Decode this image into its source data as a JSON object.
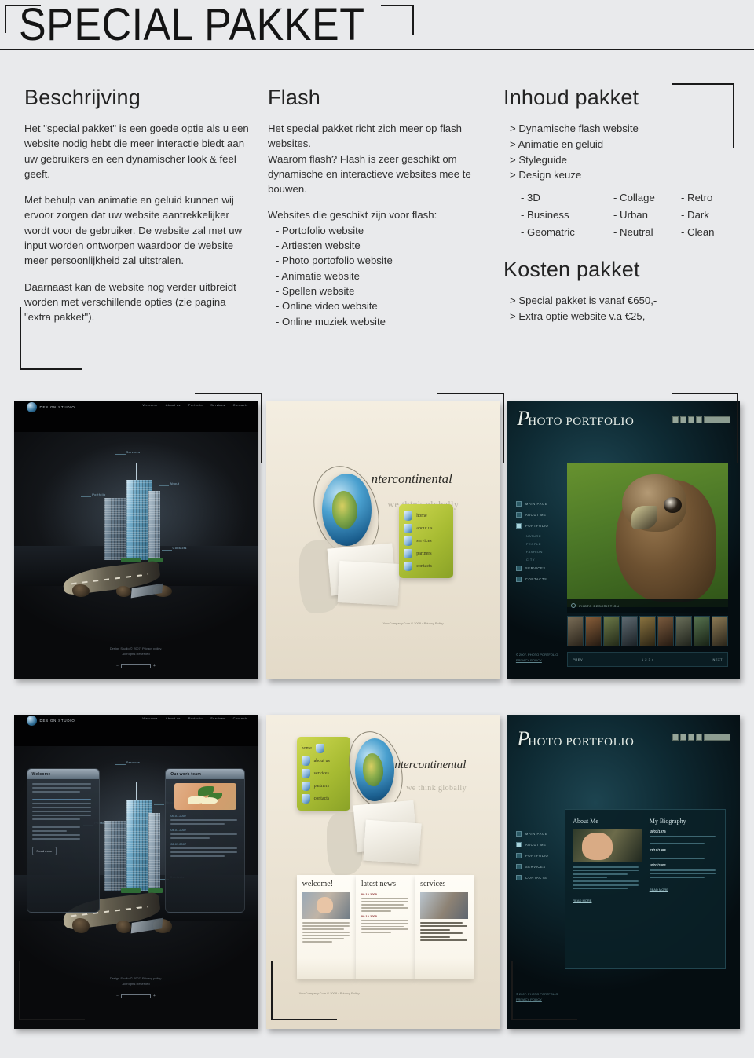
{
  "header": {
    "title": "SPECIAL PAKKET"
  },
  "col1": {
    "title": "Beschrijving",
    "p1": "Het \"special pakket\" is een goede optie als u een website nodig hebt die meer interactie biedt aan uw gebruikers en een dynamischer look & feel geeft.",
    "p2": "Met behulp van animatie en geluid kunnen wij ervoor zorgen dat uw website aantrekkelijker wordt voor de gebruiker. De website zal met uw input worden ontworpen waardoor de website meer persoonlijkheid zal uitstralen.",
    "p3": "Daarnaast kan de website nog verder uitbreidt worden met verschillende opties (zie pagina \"extra pakket\")."
  },
  "col2": {
    "title": "Flash",
    "p1": "Het special pakket richt zich meer op flash websites.",
    "p2": "Waarom flash? Flash is zeer geschikt om dynamische en interactieve websites mee te bouwen.",
    "list_intro": "Websites die geschikt zijn voor flash:",
    "items": [
      "- Portofolio website",
      "- Artiesten website",
      "- Photo portofolio website",
      "- Animatie website",
      "- Spellen website",
      "- Online video website",
      "- Online muziek website"
    ]
  },
  "col3": {
    "title": "Inhoud pakket",
    "items": [
      "> Dynamische flash website",
      "> Animatie en geluid",
      "> Styleguide",
      "> Design keuze"
    ],
    "keuze": [
      "- 3D",
      "- Collage",
      "- Retro",
      "- Business",
      "- Urban",
      "- Dark",
      "- Geomatric",
      "- Neutral",
      "- Clean"
    ],
    "kosten_title": "Kosten pakket",
    "kosten": [
      "> Special pakket is vanaf €650,-",
      "> Extra optie website v.a €25,-"
    ]
  },
  "shots": {
    "design_studio": {
      "logo": "DESIGN STUDIO",
      "nav": [
        "Welcome",
        "About us",
        "Portfolio",
        "Services",
        "Contacts"
      ],
      "labels": [
        "Services",
        "About",
        "Portfolio",
        "Contacts"
      ],
      "footer1": "Design Studio © 2007. Privacy policy.",
      "footer2": "All Rights Reserved",
      "panel_left": "Welcome",
      "panel_right": "Our work team",
      "button": "Read more",
      "dates": [
        "05.07.2007",
        "04.07.2007",
        "02.07.2007"
      ]
    },
    "intercontinental": {
      "brand": "ntercontinental",
      "tagline": "we think globally",
      "menu": [
        "home",
        "about us",
        "services",
        "partners",
        "contacts"
      ],
      "footer": "YourCompany.Com © 2008 • Privacy Policy",
      "cards": [
        "welcome!",
        "latest news",
        "services"
      ],
      "news_dates": [
        "09.12.2008",
        "09.12.2008"
      ],
      "services_list": [
        "Management Consulting",
        "Policy and Regulatory Analysis",
        "Market Assessment",
        "Program Management",
        "Regulatory Support",
        "Scientific and Risk Assessment"
      ]
    },
    "photo_portfolio": {
      "brand_initial": "P",
      "brand": "HOTO PORTFOLIO",
      "nav": [
        "MAIN PAGE",
        "ABOUT ME",
        "PORTFOLIO",
        "SERVICES",
        "CONTACTS"
      ],
      "sub_nav": [
        "NATURE",
        "PEOPLE",
        "FASHION",
        "CITY"
      ],
      "caption": "PHOTO DESCRIPTION",
      "pager_prev": "PREV",
      "pager_pages": "1 2 3 4",
      "pager_next": "NEXT",
      "footer1": "© 2007. PHOTO PORTFOLIO",
      "footer2": "PRIVACY POLICY",
      "panel_left": "About Me",
      "panel_right": "My Biography",
      "bio_dates": [
        "15/03/1975",
        "23/10/1998",
        "10/07/2002"
      ],
      "read_more": "READ MORE"
    }
  }
}
